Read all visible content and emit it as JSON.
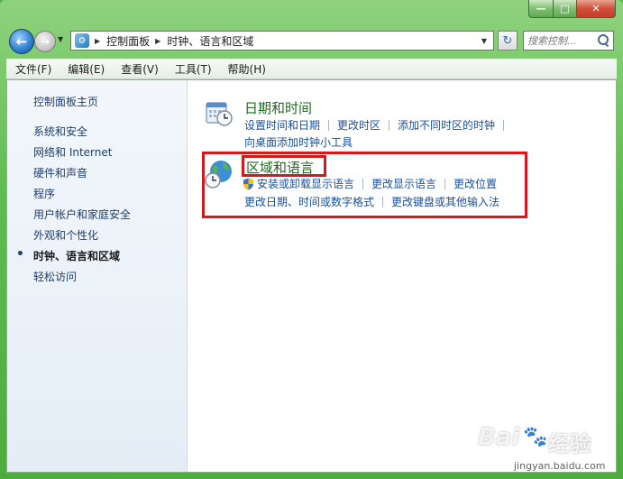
{
  "window": {
    "minimize": "—",
    "maximize": "□",
    "close": "✕"
  },
  "address_bar": {
    "crumbs": [
      "控制面板",
      "时钟、语言和区域"
    ]
  },
  "search": {
    "placeholder": "搜索控制..."
  },
  "menu": [
    "文件(F)",
    "编辑(E)",
    "查看(V)",
    "工具(T)",
    "帮助(H)"
  ],
  "left_pane": {
    "home": "控制面板主页",
    "items": [
      "系统和安全",
      "网络和 Internet",
      "硬件和声音",
      "程序",
      "用户帐户和家庭安全",
      "外观和个性化",
      "时钟、语言和区域",
      "轻松访问"
    ],
    "current": "时钟、语言和区域"
  },
  "categories": {
    "datetime": {
      "title": "日期和时间",
      "links": [
        "设置时间和日期",
        "更改时区",
        "添加不同时区的时钟"
      ],
      "links_row2": [
        "向桌面添加时钟小工具"
      ]
    },
    "region": {
      "title": "区域和语言",
      "links": [
        "安装或卸载显示语言",
        "更改显示语言",
        "更改位置"
      ],
      "links_row2": [
        "更改日期、时间或数字格式",
        "更改键盘或其他输入法"
      ]
    }
  },
  "watermark": {
    "brand": "Bai",
    "jingyan": "经验",
    "url": "jingyan.baidu.com"
  },
  "colors": {
    "frame": "#5fbd4e",
    "link": "#1b4f9c",
    "title": "#1a6c1a",
    "highlight": "#d8171c"
  }
}
